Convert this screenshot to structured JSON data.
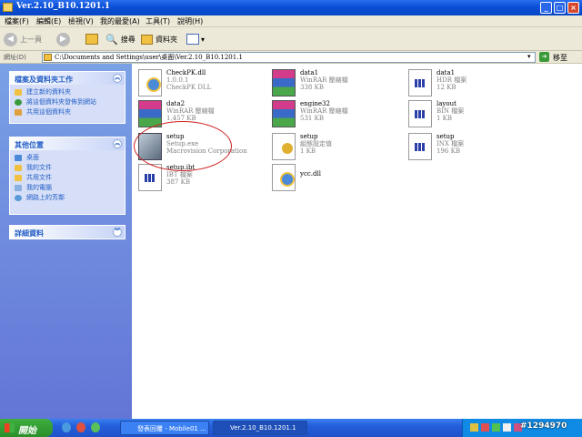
{
  "window": {
    "title": "Ver.2.10_B10.1201.1"
  },
  "menu": [
    "檔案(F)",
    "編輯(E)",
    "檢視(V)",
    "我的最愛(A)",
    "工具(T)",
    "說明(H)"
  ],
  "toolbar": {
    "back": "上一頁",
    "search": "搜尋",
    "folders": "資料夾"
  },
  "address": {
    "label": "網址(D)",
    "value": "C:\\Documents and Settings\\user\\桌面\\Ver.2.10_B10.1201.1",
    "go": "移至"
  },
  "tasks_panel": {
    "title": "檔案及資料夾工作",
    "items": [
      "建立新的資料夾",
      "將這個資料夾發佈到網站",
      "共用這個資料夾"
    ]
  },
  "places_panel": {
    "title": "其他位置",
    "items": [
      "桌面",
      "我的文件",
      "共用文件",
      "我的電腦",
      "網路上的芳鄰"
    ]
  },
  "details_panel": {
    "title": "詳細資料"
  },
  "files": [
    {
      "name": "CheckPK.dll",
      "l2": "1.0.0.1",
      "l3": "CheckPK DLL",
      "icon": "dll-icon"
    },
    {
      "name": "data1",
      "l2": "WinRAR 壓縮檔",
      "l3": "338 KB",
      "icon": "rar-icon"
    },
    {
      "name": "data1",
      "l2": "HDR 檔案",
      "l3": "12 KB",
      "icon": "doc-icon"
    },
    {
      "name": "data2",
      "l2": "WinRAR 壓縮檔",
      "l3": "1,457 KB",
      "icon": "rar-icon"
    },
    {
      "name": "engine32",
      "l2": "WinRAR 壓縮檔",
      "l3": "531 KB",
      "icon": "rar-icon"
    },
    {
      "name": "layout",
      "l2": "BIN 檔案",
      "l3": "1 KB",
      "icon": "doc-icon"
    },
    {
      "name": "setup",
      "l2": "Setup.exe",
      "l3": "Macrovision Corporation",
      "icon": "setup-icon"
    },
    {
      "name": "setup",
      "l2": "組態設定值",
      "l3": "1 KB",
      "icon": "ini-icon"
    },
    {
      "name": "setup",
      "l2": "INX 檔案",
      "l3": "196 KB",
      "icon": "doc-icon"
    },
    {
      "name": "setup.ibt",
      "l2": "IBT 檔案",
      "l3": "387 KB",
      "icon": "doc-icon"
    },
    {
      "name": "ycc.dll",
      "l2": "",
      "l3": "",
      "icon": "dll-icon"
    }
  ],
  "taskbar": {
    "start": "開始",
    "tasks": [
      "發表回覆 - Mobile01 ...",
      "Ver.2.10_B10.1201.1"
    ],
    "watermark": "#1294970"
  }
}
